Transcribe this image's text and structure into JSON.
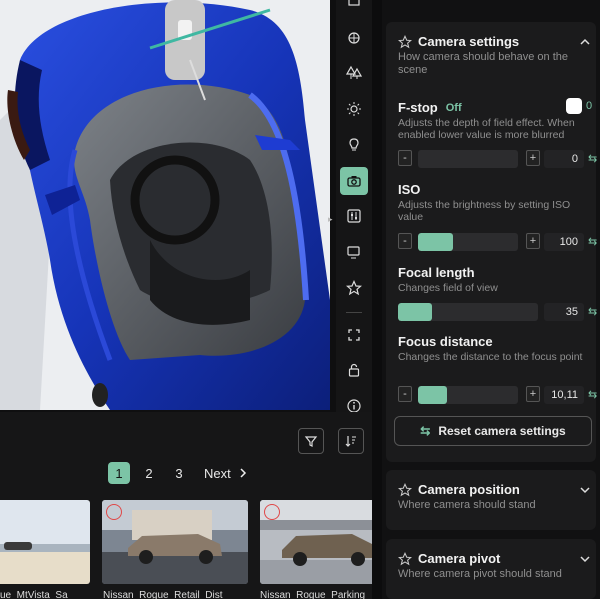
{
  "toolbar": {
    "items": [
      {
        "icon": "cube-icon"
      },
      {
        "icon": "environment-icon"
      },
      {
        "icon": "trees-icon"
      },
      {
        "icon": "sun-icon"
      },
      {
        "icon": "lightbulb-icon"
      },
      {
        "icon": "camera-icon",
        "active": true
      },
      {
        "icon": "adjustments-icon"
      },
      {
        "icon": "cast-icon"
      },
      {
        "icon": "star-icon"
      },
      {
        "icon": "fullscreen-icon"
      },
      {
        "icon": "lock-icon"
      },
      {
        "icon": "info-icon"
      }
    ]
  },
  "browser": {
    "pages": [
      "1",
      "2",
      "3"
    ],
    "active_page": "1",
    "next_label": "Next",
    "thumbnails": [
      {
        "caption": "ue_MtVista_Sa"
      },
      {
        "caption": "Nissan_Rogue_Retail_Dist"
      },
      {
        "caption": "Nissan_Rogue_Parking"
      }
    ]
  },
  "camera_settings": {
    "title": "Camera settings",
    "subtitle": "How camera should behave on the scene",
    "fstop": {
      "title": "F-stop",
      "state": "Off",
      "toggle_value": "0",
      "description": "Adjusts the depth of field effect. When enabled lower value is more blurred",
      "value": "0",
      "fill_fraction": 0.0
    },
    "iso": {
      "title": "ISO",
      "description": "Adjusts the brightness by setting ISO value",
      "value": "100",
      "fill_fraction": 0.35
    },
    "focal_length": {
      "title": "Focal length",
      "description": "Changes field of view",
      "value": "35",
      "fill_fraction": 0.24
    },
    "focus_distance": {
      "title": "Focus distance",
      "description": "Changes the distance to the focus point",
      "value": "10,11",
      "fill_fraction": 0.29
    },
    "reset_label": "Reset camera settings"
  },
  "camera_position": {
    "title": "Camera position",
    "subtitle": "Where camera should stand"
  },
  "camera_pivot": {
    "title": "Camera pivot",
    "subtitle": "Where camera pivot should stand"
  },
  "colors": {
    "accent": "#7cc4a6",
    "car_body": "#1a3bc0",
    "panel_bg": "#1b1b1c"
  }
}
